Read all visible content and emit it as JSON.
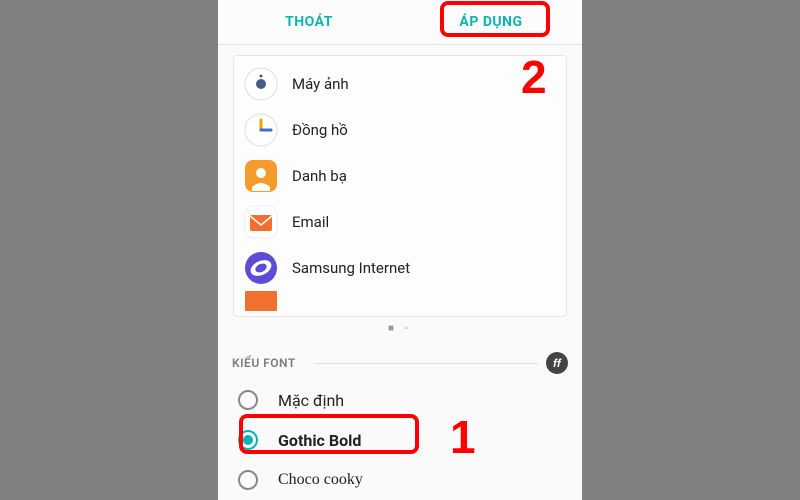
{
  "topbar": {
    "exit_label": "THOÁT",
    "apply_label": "ÁP DỤNG"
  },
  "apps": [
    {
      "id": "camera",
      "label": "Máy ảnh"
    },
    {
      "id": "clock",
      "label": "Đồng hồ"
    },
    {
      "id": "contacts",
      "label": "Danh bạ"
    },
    {
      "id": "email",
      "label": "Email"
    },
    {
      "id": "internet",
      "label": "Samsung Internet"
    }
  ],
  "pager": "■ ◦",
  "section": {
    "title": "KIỂU FONT",
    "badge": "ff"
  },
  "fonts": [
    {
      "id": "default",
      "label": "Mặc định",
      "selected": false,
      "class": ""
    },
    {
      "id": "gothic-bold",
      "label": "Gothic Bold",
      "selected": true,
      "class": "bold"
    },
    {
      "id": "choco-cooky",
      "label": "Choco cooky",
      "selected": false,
      "class": "cooky"
    }
  ],
  "annotations": {
    "step1": "1",
    "step2": "2"
  }
}
